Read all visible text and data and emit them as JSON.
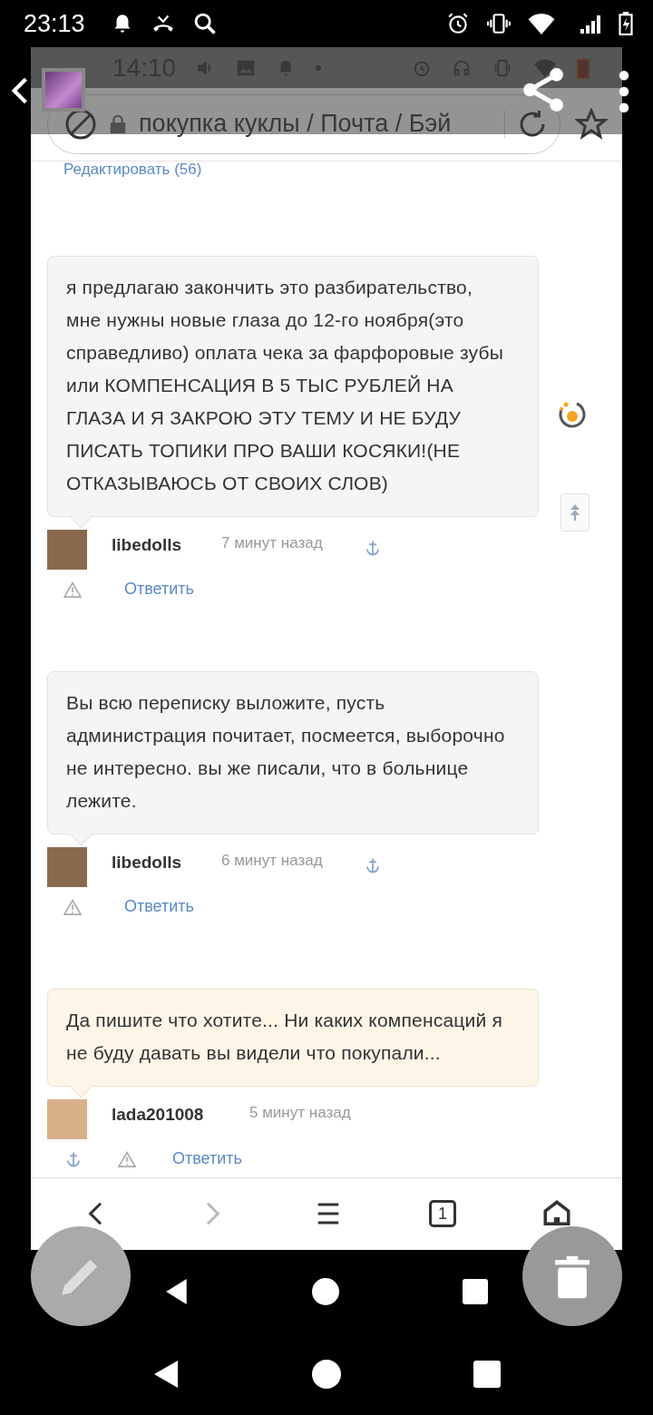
{
  "status_bar": {
    "time": "23:13"
  },
  "inner_status_bar": {
    "time": "14:10"
  },
  "address_bar": {
    "url": "покупка куклы / Почта / Бэй"
  },
  "edit_link": "Редактировать (56)",
  "comments": [
    {
      "text": "я предлагаю закончить это разбирательство, мне нужны новые глаза до 12-го ноября(это справедливо) оплата чека за фарфоровые зубы или КОМПЕНСАЦИЯ В 5 ТЫС РУБЛЕЙ НА ГЛАЗА И Я ЗАКРОЮ ЭТУ ТЕМУ И НЕ БУДУ ПИСАТЬ ТОПИКИ ПРО ВАШИ КОСЯКИ!(НЕ ОТКАЗЫВАЮСЬ ОТ СВОИХ СЛОВ)",
      "author": "libedolls",
      "time": "7 минут назад",
      "reply": "Ответить",
      "own": false
    },
    {
      "text": "Вы всю переписку выложите, пусть администрация почитает, посмеется, выборочно не интересно. вы же писали, что в больнице лежите.",
      "author": "libedolls",
      "time": "6 минут назад",
      "reply": "Ответить",
      "own": false
    },
    {
      "text": "Да пишите что хотите... Ни каких компенсаций я не буду давать вы видели что покупали...",
      "author": "lada201008",
      "time": "5 минут назад",
      "reply": "Ответить",
      "own": true
    }
  ],
  "toolbar": [
    {
      "kind": "back",
      "disabled": false
    },
    {
      "kind": "forward",
      "disabled": true
    },
    {
      "kind": "menu",
      "disabled": false
    },
    {
      "kind": "tabs",
      "count": "1",
      "disabled": false
    },
    {
      "kind": "home",
      "disabled": false
    }
  ]
}
